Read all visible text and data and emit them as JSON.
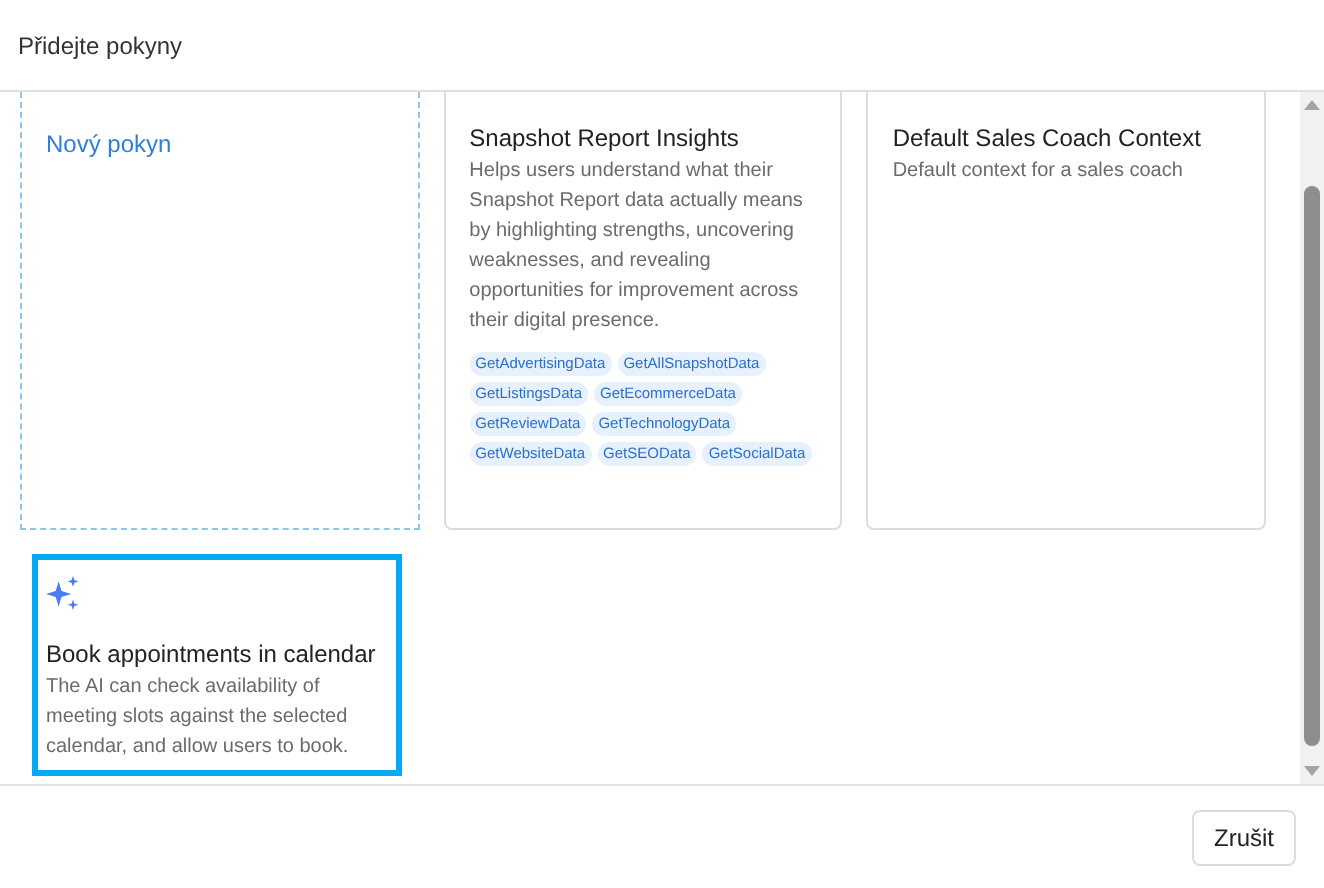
{
  "dialog": {
    "title": "Přidejte pokyny"
  },
  "cards": [
    {
      "kind": "new",
      "title": "Nový pokyn",
      "selected": false
    },
    {
      "kind": "instruction",
      "title": "Snapshot Report Insights",
      "description": "Helps users understand what their Snapshot Report data actually means by highlighting strengths, uncovering weaknesses, and revealing opportunities for improvement across their digital presence.",
      "tags": [
        "GetAdvertisingData",
        "GetAllSnapshotData",
        "GetListingsData",
        "GetEcommerceData",
        "GetReviewData",
        "GetTechnologyData",
        "GetWebsiteData",
        "GetSEOData",
        "GetSocialData"
      ],
      "icon": false,
      "selected": false
    },
    {
      "kind": "instruction",
      "title": "Default Sales Coach Context",
      "description": "Default context for a sales coach",
      "icon": false,
      "selected": false
    },
    {
      "kind": "instruction",
      "title": "Book appointments in calendar",
      "description": "The AI can check availability of meeting slots against the selected calendar, and allow users to book.",
      "icon": true,
      "selected": true
    }
  ],
  "buttons": [
    {
      "label": "Zrušit"
    }
  ]
}
